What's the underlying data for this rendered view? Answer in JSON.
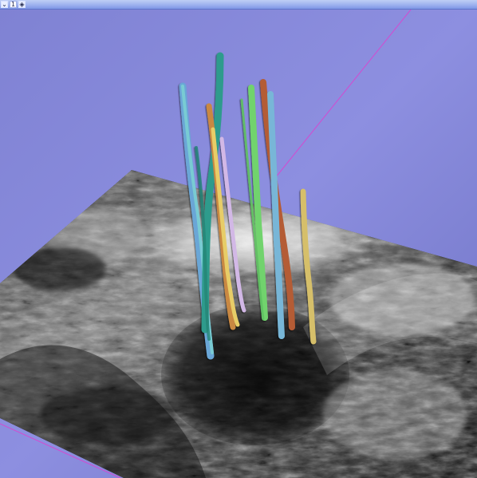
{
  "viewer": {
    "view_number": "1",
    "pin_symbol": "⌄",
    "link_symbol": "◈"
  },
  "scene": {
    "background_colors": [
      "#7f82d3",
      "#8d8fe0",
      "#6f73c4"
    ],
    "volume_colors": [
      "#000000",
      "#303030",
      "#9a9a9a",
      "#f4f4f4"
    ],
    "fiber_colors": [
      "#75b7c8",
      "#2f9b8c",
      "#71d36d",
      "#c98842",
      "#e7cd67",
      "#d2b8e6",
      "#6aa6d6"
    ]
  }
}
